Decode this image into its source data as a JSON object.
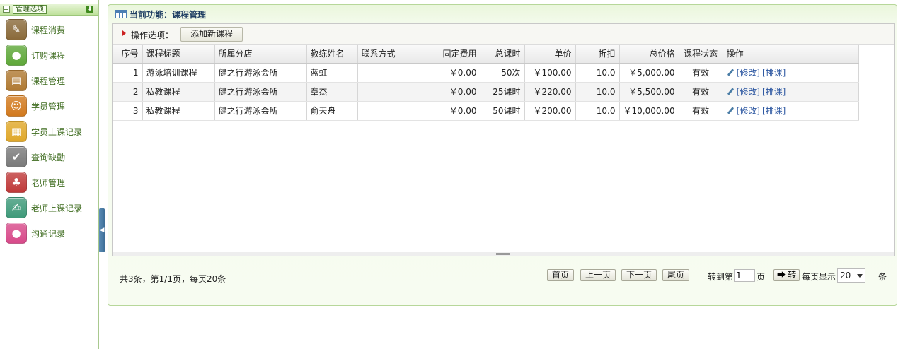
{
  "sidebar": {
    "title": "管理选项",
    "items": [
      {
        "label": "课程消费",
        "icon": "ticket-icon",
        "color": "#8a6a3a"
      },
      {
        "label": "订购课程",
        "icon": "ball-icon",
        "color": "#5fa83a"
      },
      {
        "label": "课程管理",
        "icon": "notebook-icon",
        "color": "#b07a33"
      },
      {
        "label": "学员管理",
        "icon": "users-icon",
        "color": "#d27a1e"
      },
      {
        "label": "学员上课记录",
        "icon": "records-icon",
        "color": "#e0a82a"
      },
      {
        "label": "查询缺勤",
        "icon": "checkin-icon",
        "color": "#7a7a7a"
      },
      {
        "label": "老师管理",
        "icon": "teacher-icon",
        "color": "#c03a3a"
      },
      {
        "label": "老师上课记录",
        "icon": "pen-record-icon",
        "color": "#3f9a7a"
      },
      {
        "label": "沟通记录",
        "icon": "chat-icon",
        "color": "#d84a8a"
      }
    ]
  },
  "header": {
    "title": "当前功能：课程管理"
  },
  "ops": {
    "label": "操作选项：",
    "add_button": "添加新课程"
  },
  "table": {
    "columns": [
      "序号",
      "课程标题",
      "所属分店",
      "教练姓名",
      "联系方式",
      "固定费用",
      "总课时",
      "单价",
      "折扣",
      "总价格",
      "课程状态",
      "操作"
    ],
    "rows": [
      {
        "no": "1",
        "title": "游泳培训课程",
        "branch": "健之行游泳会所",
        "coach": "蓝虹",
        "contact": "",
        "fixed_fee": "￥0.00",
        "total_lessons": "50次",
        "unit_price": "￥100.00",
        "discount": "10.0",
        "total_price": "￥5,000.00",
        "status": "有效",
        "edit": "[修改]",
        "schedule": "[排课]"
      },
      {
        "no": "2",
        "title": "私教课程",
        "branch": "健之行游泳会所",
        "coach": "章杰",
        "contact": "",
        "fixed_fee": "￥0.00",
        "total_lessons": "25课时",
        "unit_price": "￥220.00",
        "discount": "10.0",
        "total_price": "￥5,500.00",
        "status": "有效",
        "edit": "[修改]",
        "schedule": "[排课]"
      },
      {
        "no": "3",
        "title": "私教课程",
        "branch": "健之行游泳会所",
        "coach": "俞天舟",
        "contact": "",
        "fixed_fee": "￥0.00",
        "total_lessons": "50课时",
        "unit_price": "￥200.00",
        "discount": "10.0",
        "total_price": "￥10,000.00",
        "status": "有效",
        "edit": "[修改]",
        "schedule": "[排课]"
      }
    ]
  },
  "pager": {
    "summary": "共3条，第1/1页，每页20条",
    "first": "首页",
    "prev": "上一页",
    "next": "下一页",
    "last": "尾页",
    "goto_prefix": "转到第",
    "goto_value": "1",
    "goto_suffix": "页",
    "go": "➡ 转",
    "per_page_label": "每页显示",
    "per_page_value": "20",
    "per_page_suffix": "条"
  }
}
